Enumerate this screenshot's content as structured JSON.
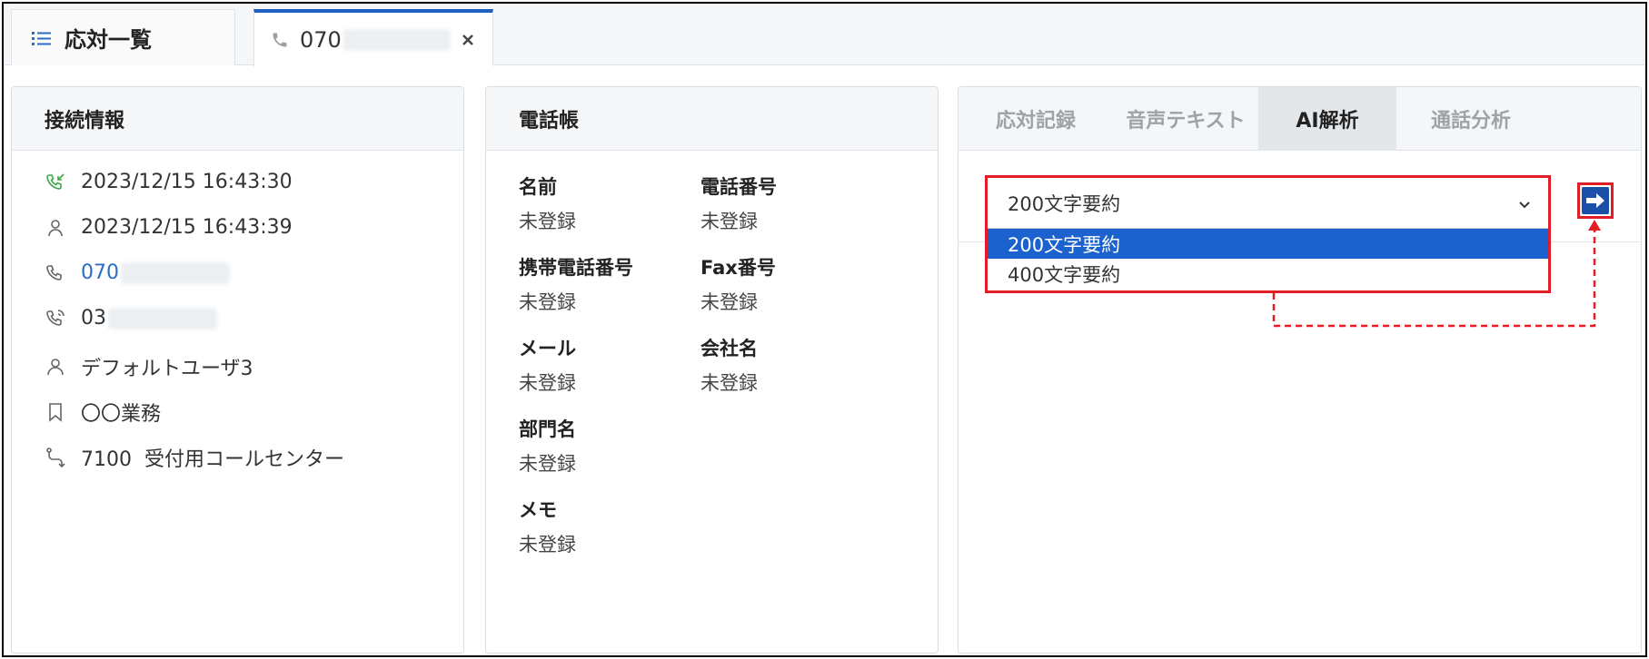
{
  "tabs": {
    "list_label": "応対一覧",
    "call_prefix": "070"
  },
  "connection": {
    "title": "接続情報",
    "received_time": "2023/12/15 16:43:30",
    "answered_time": "2023/12/15 16:43:39",
    "caller_prefix": "070",
    "callee_prefix": "03",
    "user": "デフォルトユーザ3",
    "business": "〇〇業務",
    "route": "7100  受付用コールセンター"
  },
  "phonebook": {
    "title": "電話帳",
    "fields": [
      {
        "label": "名前",
        "value": "未登録"
      },
      {
        "label": "電話番号",
        "value": "未登録"
      },
      {
        "label": "携帯電話番号",
        "value": "未登録"
      },
      {
        "label": "Fax番号",
        "value": "未登録"
      },
      {
        "label": "メール",
        "value": "未登録"
      },
      {
        "label": "会社名",
        "value": "未登録"
      },
      {
        "label": "部門名",
        "value": "未登録"
      },
      {
        "label": "メモ",
        "value": "未登録"
      }
    ]
  },
  "analysis": {
    "tabs": [
      "応対記録",
      "音声テキスト",
      "AI解析",
      "通話分析"
    ],
    "active_tab": "AI解析",
    "select_value": "200文字要約",
    "options": [
      "200文字要約",
      "400文字要約"
    ]
  },
  "colors": {
    "accent": "#1b62cf",
    "highlight": "#e11e26",
    "link": "#2a6cc7",
    "incoming_icon": "#3aa845"
  }
}
